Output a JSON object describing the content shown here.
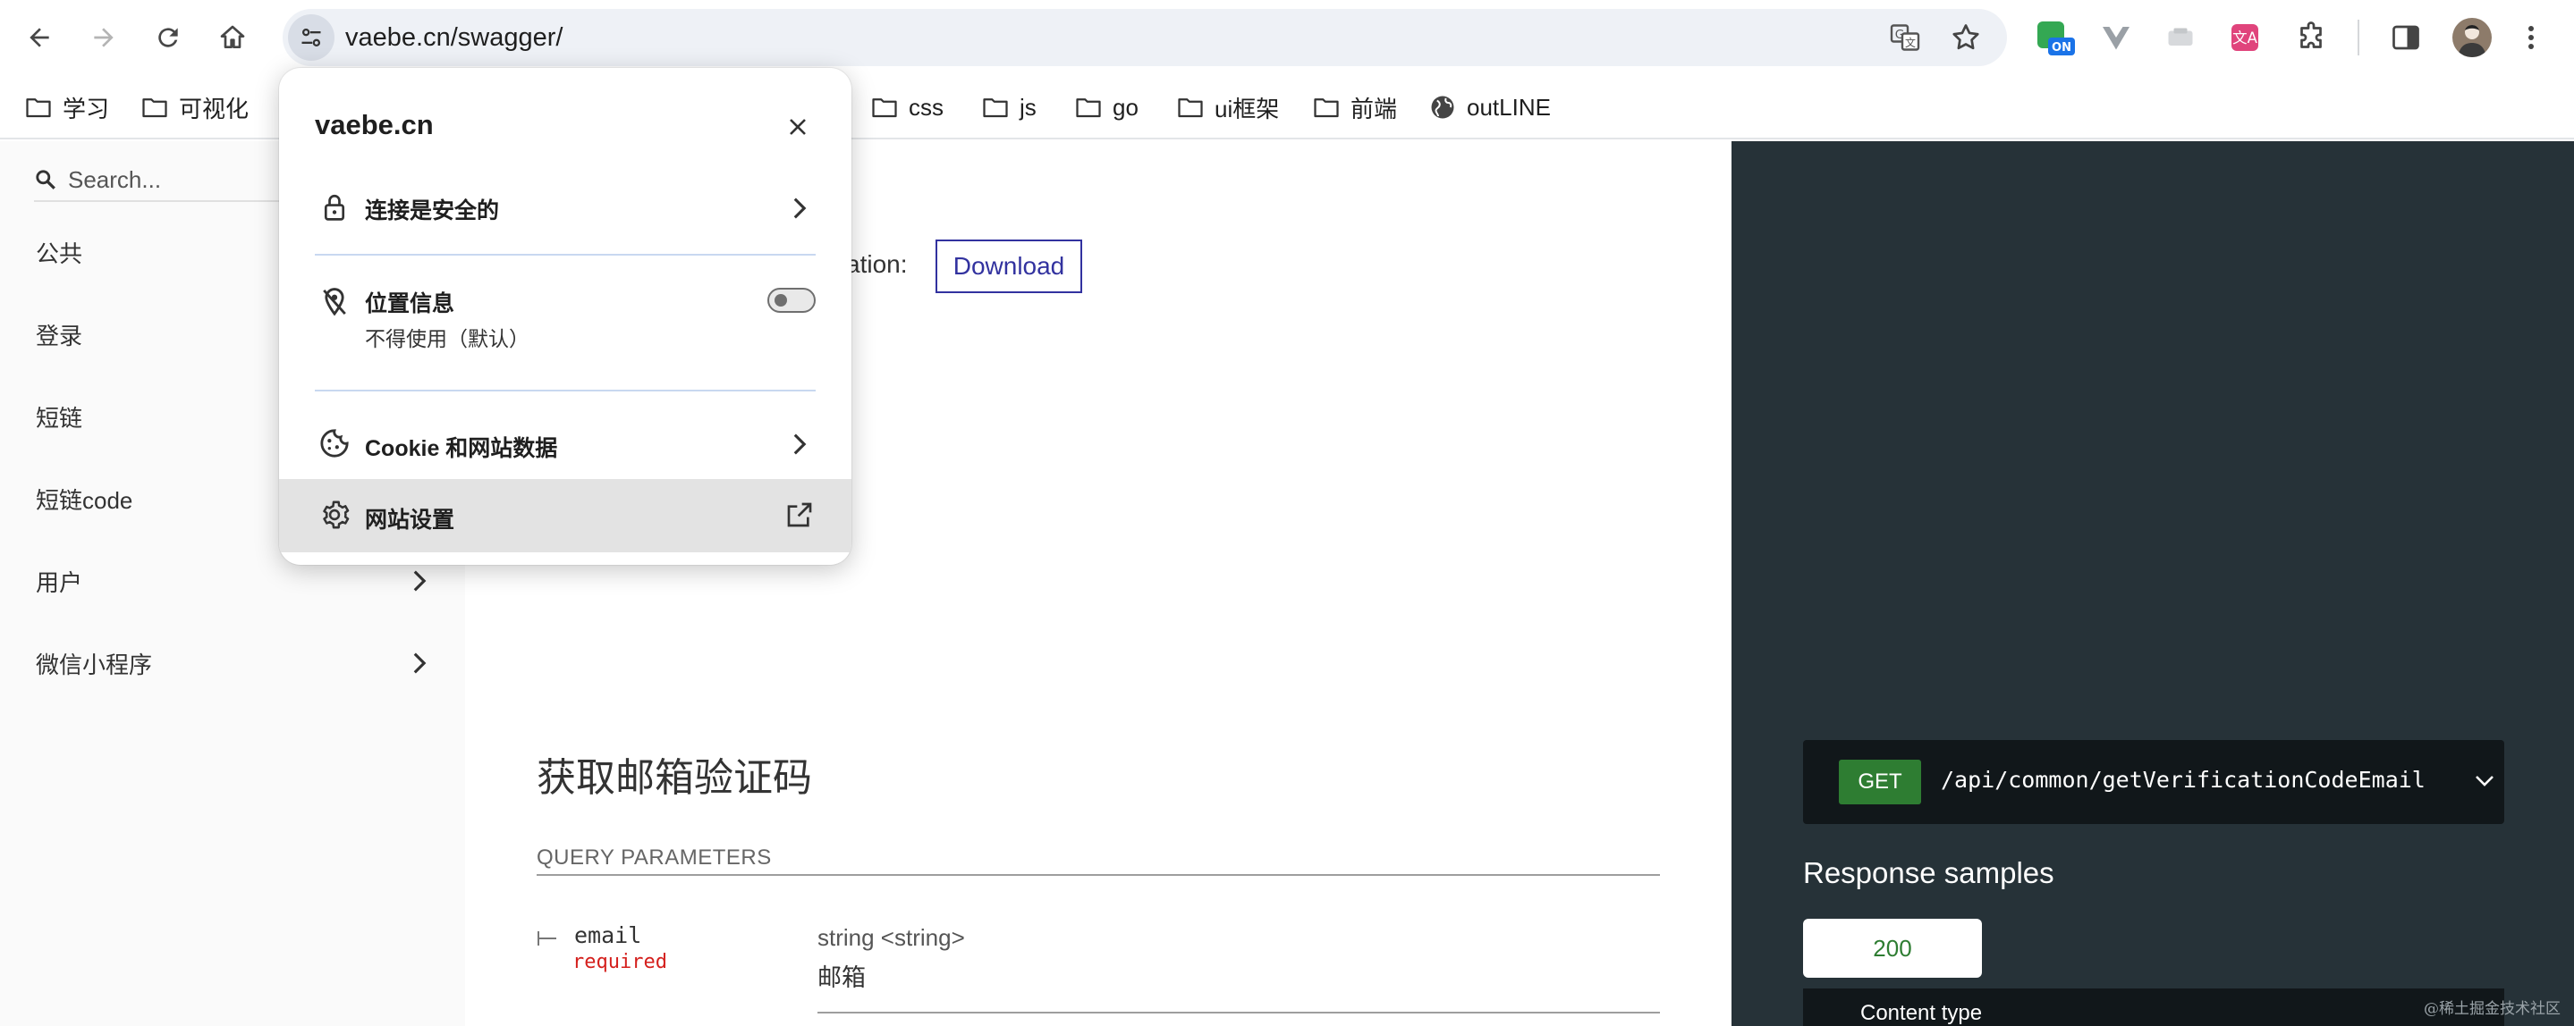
{
  "browser": {
    "url": "vaebe.cn/swagger/"
  },
  "bookmarks": [
    {
      "label": "学习"
    },
    {
      "label": "可视化"
    },
    {
      "label": "css"
    },
    {
      "label": "js"
    },
    {
      "label": "go"
    },
    {
      "label": "ui框架"
    },
    {
      "label": "前端"
    },
    {
      "label": "outLINE"
    }
  ],
  "sidebar": {
    "search_placeholder": "Search...",
    "items": [
      {
        "label": "公共"
      },
      {
        "label": "登录"
      },
      {
        "label": "短链"
      },
      {
        "label": "短链code"
      },
      {
        "label": "用户"
      },
      {
        "label": "微信小程序"
      }
    ]
  },
  "main": {
    "download_prefix": "cation:",
    "download_label": "Download",
    "section_title": "获取邮箱验证码",
    "query_params_heading": "QUERY PARAMETERS",
    "param": {
      "name": "email",
      "required": "required",
      "type": "string <string>",
      "description": "邮箱"
    }
  },
  "right_panel": {
    "method": "GET",
    "path": "/api/common/getVerificationCodeEmail",
    "response_samples_title": "Response samples",
    "status_tab": "200",
    "content_type_label": "Content type"
  },
  "popup": {
    "site": "vaebe.cn",
    "secure_label": "连接是安全的",
    "location_label": "位置信息",
    "location_sub": "不得使用（默认）",
    "location_toggle_on": false,
    "cookie_label": "Cookie 和网站数据",
    "site_settings_label": "网站设置"
  },
  "watermark": "@稀土掘金技术社区",
  "colors": {
    "get_badge": "#2e7d32",
    "status_text": "#2e7d32",
    "right_panel_bg": "#263238",
    "download_border": "#32329f",
    "required_text": "#d41f1c"
  }
}
